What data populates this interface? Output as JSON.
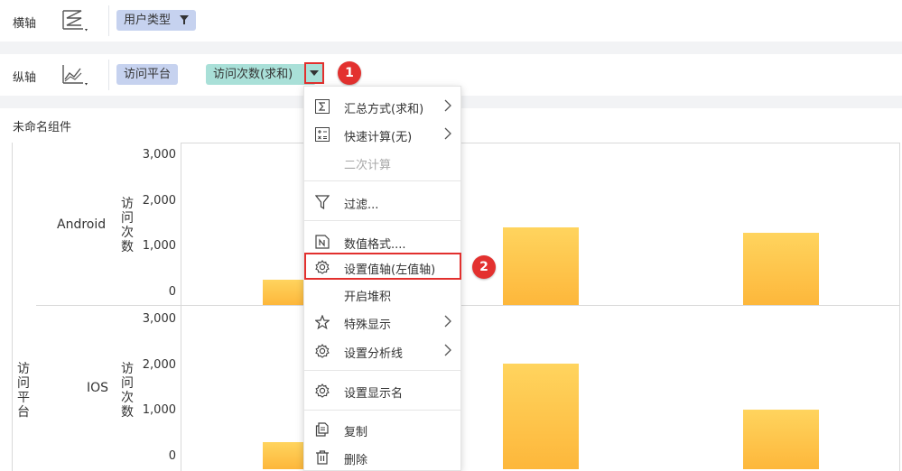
{
  "x_axis": {
    "label": "横轴",
    "field": "用户类型"
  },
  "y_axis": {
    "label": "纵轴",
    "fields": [
      "访问平台",
      "访问次数(求和)"
    ]
  },
  "badges": [
    "1",
    "2"
  ],
  "chart": {
    "title": "未命名组件",
    "row_dimension": "访问平台",
    "measure_label": "访问次数",
    "ticks": [
      "3,000",
      "2,000",
      "1,000",
      "0"
    ]
  },
  "menu": {
    "items": [
      {
        "label": "汇总方式(求和)",
        "icon": "sigma-icon",
        "submenu": true
      },
      {
        "label": "快速计算(无)",
        "icon": "calculator-icon",
        "submenu": true
      },
      {
        "label": "二次计算",
        "icon": "",
        "disabled": true
      },
      {
        "label": "过滤...",
        "icon": "filter-icon"
      },
      {
        "label": "数值格式....",
        "icon": "number-format-icon"
      },
      {
        "label": "设置值轴(左值轴)",
        "icon": "gear-icon"
      },
      {
        "label": "开启堆积",
        "icon": ""
      },
      {
        "label": "特殊显示",
        "icon": "star-icon",
        "submenu": true
      },
      {
        "label": "设置分析线",
        "icon": "gear-icon",
        "submenu": true
      },
      {
        "label": "设置显示名",
        "icon": "gear-icon"
      },
      {
        "label": "复制",
        "icon": "copy-icon"
      },
      {
        "label": "删除",
        "icon": "trash-icon"
      }
    ]
  },
  "chart_data": {
    "type": "bar",
    "ylim": [
      0,
      3000
    ],
    "panels": [
      {
        "category": "Android",
        "values": [
          550,
          1700,
          1580
        ]
      },
      {
        "category": "IOS",
        "values": [
          600,
          2300,
          1300
        ]
      }
    ],
    "colors": [
      "#ffd45e",
      "#fdb73b"
    ]
  }
}
